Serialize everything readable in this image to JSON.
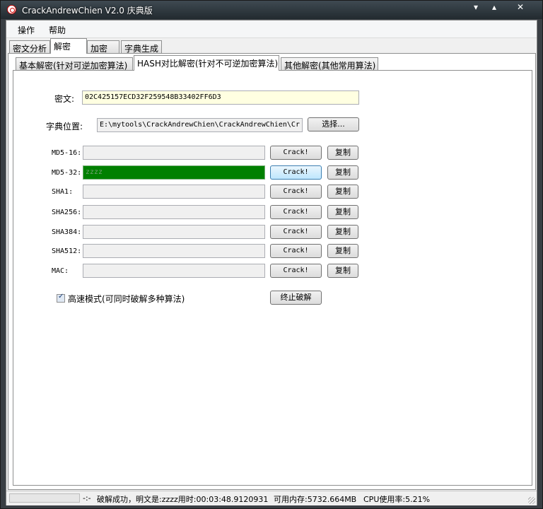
{
  "window": {
    "title": "CrackAndrewChien V2.0 庆典版",
    "controls": [
      "▾",
      "▴",
      "✕"
    ]
  },
  "menu": [
    "操作",
    "帮助"
  ],
  "main_tabs": [
    "密文分析",
    "解密",
    "加密",
    "字典生成"
  ],
  "sub_tabs": [
    "基本解密(针对可逆加密算法)",
    "HASH对比解密(针对不可逆加密算法)",
    "其他解密(其他常用算法)"
  ],
  "form": {
    "cipher_label": "密文:",
    "cipher_value": "02C425157ECD32F259548B33402FF6D3",
    "dict_label": "字典位置:",
    "dict_value": "E:\\mytools\\CrackAndrewChien\\CrackAndrewChien\\Cr",
    "choose_label": "选择...",
    "crack_label": "Crack!",
    "copy_label": "复制",
    "rows": [
      {
        "label": "MD5-16:",
        "value": ""
      },
      {
        "label": "MD5-32:",
        "value": "zzzz"
      },
      {
        "label": "SHA1:",
        "value": ""
      },
      {
        "label": "SHA256:",
        "value": ""
      },
      {
        "label": "SHA384:",
        "value": ""
      },
      {
        "label": "SHA512:",
        "value": ""
      },
      {
        "label": "MAC:",
        "value": ""
      }
    ],
    "highspeed_label": "高速模式(可同时破解多种算法)",
    "highspeed_checked": true,
    "stop_label": "终止破解"
  },
  "status": {
    "indicator": "-:-",
    "message": "破解成功，明文是:zzzz用时:00:03:48.9120931",
    "memory": "可用内存:5732.664MB",
    "cpu": "CPU使用率:5.21%"
  },
  "colors": {
    "found_field": "#008000",
    "cipher_field": "#ffffe1"
  }
}
